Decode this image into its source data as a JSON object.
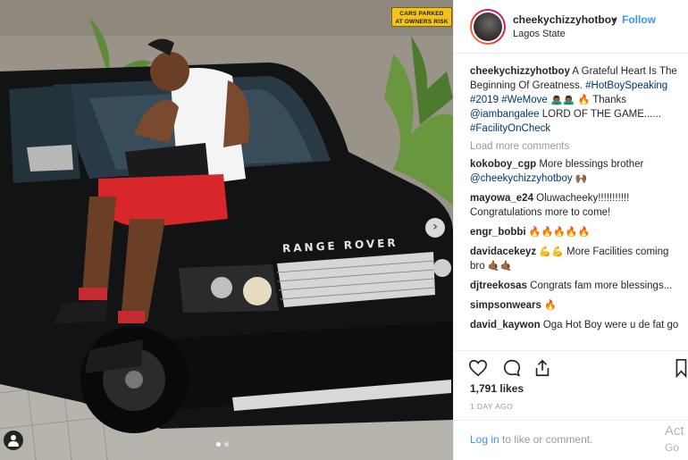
{
  "photo": {
    "sign_line1": "CARS PARKED",
    "sign_line2": "AT OWNERS RISK",
    "car_brand": "RANGE ROVER",
    "next_icon": "chevron-right-icon",
    "next_glyph": "›",
    "tag_icon": "user-tag-icon",
    "carousel_total": 2,
    "carousel_active": 1
  },
  "header": {
    "username": "cheekychizzyhotboy",
    "separator": "•",
    "follow_label": "Follow",
    "location": "Lagos State"
  },
  "caption": {
    "username": "cheekychizzyhotboy",
    "text1": "A Grateful Heart Is The Beginning Of Greatness.",
    "hashtag1": "#HotBoySpeaking",
    "hashtag2": "#2019",
    "hashtag3": "#WeMove",
    "emoji1": "🙇🏾‍♂️🙇🏾‍♂️",
    "emoji2": "🔥",
    "text2": "Thanks",
    "mention": "@iambangalee",
    "text3": "LORD OF THE GAME......",
    "hashtag4": "#FacilityOnCheck"
  },
  "load_more": "Load more comments",
  "comments": [
    {
      "user": "kokoboy_cgp",
      "text": "More blessings brother",
      "mention": "@cheekychizzyhotboy",
      "emoji": "🙌🏾"
    },
    {
      "user": "mayowa_e24",
      "text": "Oluwacheeky!!!!!!!!!!! Congratulations more to come!",
      "mention": "",
      "emoji": ""
    },
    {
      "user": "engr_bobbi",
      "text": "",
      "mention": "",
      "emoji": "🔥🔥🔥🔥🔥"
    },
    {
      "user": "davidacekeyz",
      "text": "More Facilities coming bro",
      "mention": "",
      "emoji": "💪💪",
      "emoji_after": "🤙🏾🤙🏾"
    },
    {
      "user": "djtreekosas",
      "text": "Congrats fam more blessings...",
      "mention": "",
      "emoji": ""
    },
    {
      "user": "simpsonwears",
      "text": "",
      "mention": "",
      "emoji": "🔥"
    },
    {
      "user": "david_kaywon",
      "text": "Oga Hot Boy were u de fat go",
      "mention": "",
      "emoji": ""
    }
  ],
  "actions": {
    "like_icon": "heart-icon",
    "comment_icon": "comment-icon",
    "share_icon": "share-icon",
    "save_icon": "bookmark-icon"
  },
  "likes": "1,791 likes",
  "date": "1 DAY AGO",
  "login": {
    "link": "Log in",
    "rest": " to like or comment."
  },
  "watermark": {
    "line1": "Act",
    "line2": "Go to"
  },
  "colors": {
    "accent": "#3897f0",
    "link": "#003569",
    "muted": "#999999",
    "sign": "#f2c318"
  }
}
